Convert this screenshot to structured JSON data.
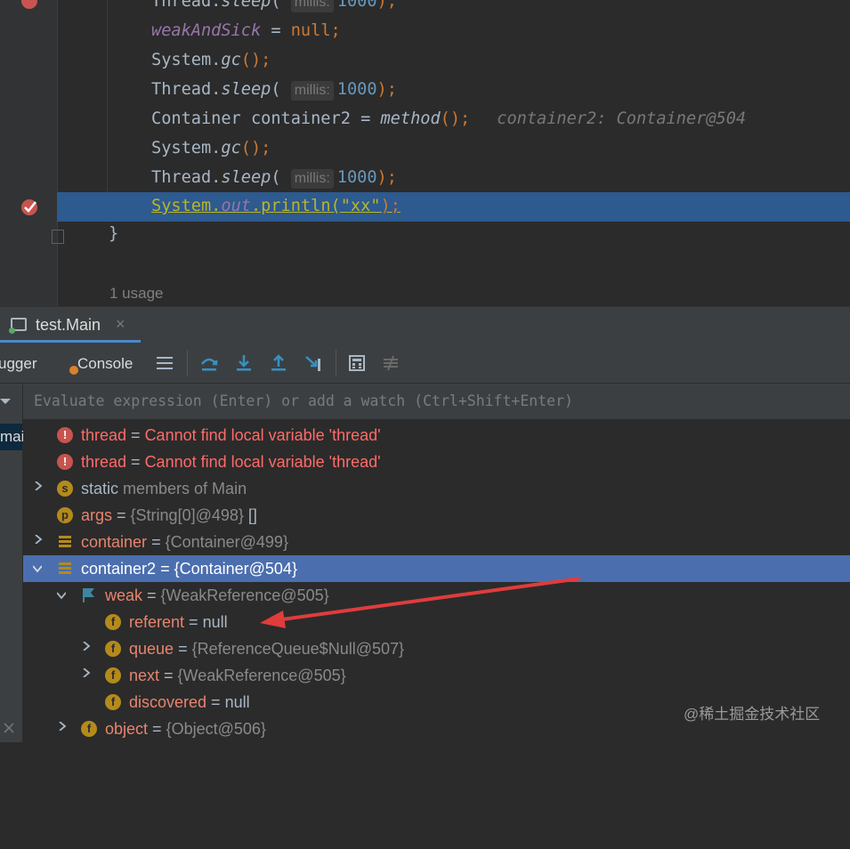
{
  "editor": {
    "lines": [
      {
        "pre": "Thread.",
        "method": "sleep",
        "open": "(",
        "hint": "millis:",
        "num": "1000",
        "close": ");"
      },
      {
        "field": "weakAndSick",
        "rest": " = ",
        "kw": "null",
        "end": ";"
      },
      {
        "pre": "System.",
        "method": "gc",
        "close": "();"
      },
      {
        "pre": "Thread.",
        "method": "sleep",
        "open": "(",
        "hint": "millis:",
        "num": "1000",
        "close": ");"
      },
      {
        "pre": "Container container2 = ",
        "method": "method",
        "close": "();",
        "inline_value": "container2: Container@504"
      },
      {
        "pre": "System.",
        "method": "gc",
        "close": "();"
      },
      {
        "pre": "Thread.",
        "method": "sleep",
        "open": "(",
        "hint": "millis:",
        "num": "1000",
        "close": ");"
      },
      {
        "pre": "System.",
        "method": "out",
        "mid": ".println(",
        "str": "\"xx\"",
        "close": ");"
      }
    ],
    "closing_brace": "}",
    "usage_hint": "1 usage"
  },
  "tool_window": {
    "tab_label": "test.Main",
    "tab_close": "×"
  },
  "toolbar": {
    "debugger_label": "ugger",
    "console_label": "Console"
  },
  "frames": {
    "selected_label": "mai"
  },
  "watch": {
    "placeholder": "Evaluate expression (Enter) or add a watch (Ctrl+Shift+Enter)"
  },
  "variables": [
    {
      "name": "thread",
      "sep": " = ",
      "value": "Cannot find local variable 'thread'",
      "icon": "error-icon",
      "icon_glyph": "!"
    },
    {
      "name": "thread",
      "sep": " = ",
      "value": "Cannot find local variable 'thread'",
      "icon": "error-icon",
      "icon_glyph": "!"
    },
    {
      "name": "static",
      "sep": " ",
      "value": "members of Main",
      "icon": "static-icon",
      "icon_glyph": "s"
    },
    {
      "name": "args",
      "sep": " = ",
      "value": "{String[0]@498}",
      "extra": " []",
      "icon": "param-icon",
      "icon_glyph": "p"
    },
    {
      "name": "container",
      "sep": " = ",
      "value": "{Container@499}",
      "icon": "object-icon"
    },
    {
      "name": "container2",
      "sep": " = ",
      "value": "{Container@504}",
      "icon": "object-icon"
    },
    {
      "name": "weak",
      "sep": " = ",
      "value": "{WeakReference@505}",
      "icon": "flag-icon"
    },
    {
      "name": "referent",
      "sep": " = ",
      "value": "null",
      "icon": "field-icon",
      "icon_glyph": "f"
    },
    {
      "name": "queue",
      "sep": " = ",
      "value": "{ReferenceQueue$Null@507}",
      "icon": "field-icon",
      "icon_glyph": "f"
    },
    {
      "name": "next",
      "sep": " = ",
      "value": "{WeakReference@505}",
      "icon": "field-icon",
      "icon_glyph": "f"
    },
    {
      "name": "discovered",
      "sep": " = ",
      "value": "null",
      "icon": "field-icon",
      "icon_glyph": "f"
    },
    {
      "name": "object",
      "sep": " = ",
      "value": "{Object@506}",
      "icon": "field-icon",
      "icon_glyph": "f"
    }
  ],
  "watermark": "@稀土掘金技术社区",
  "colors": {
    "selection": "#4b6eaf",
    "active_line": "#2d5a8f",
    "annotation_arrow": "#e03c3c"
  }
}
